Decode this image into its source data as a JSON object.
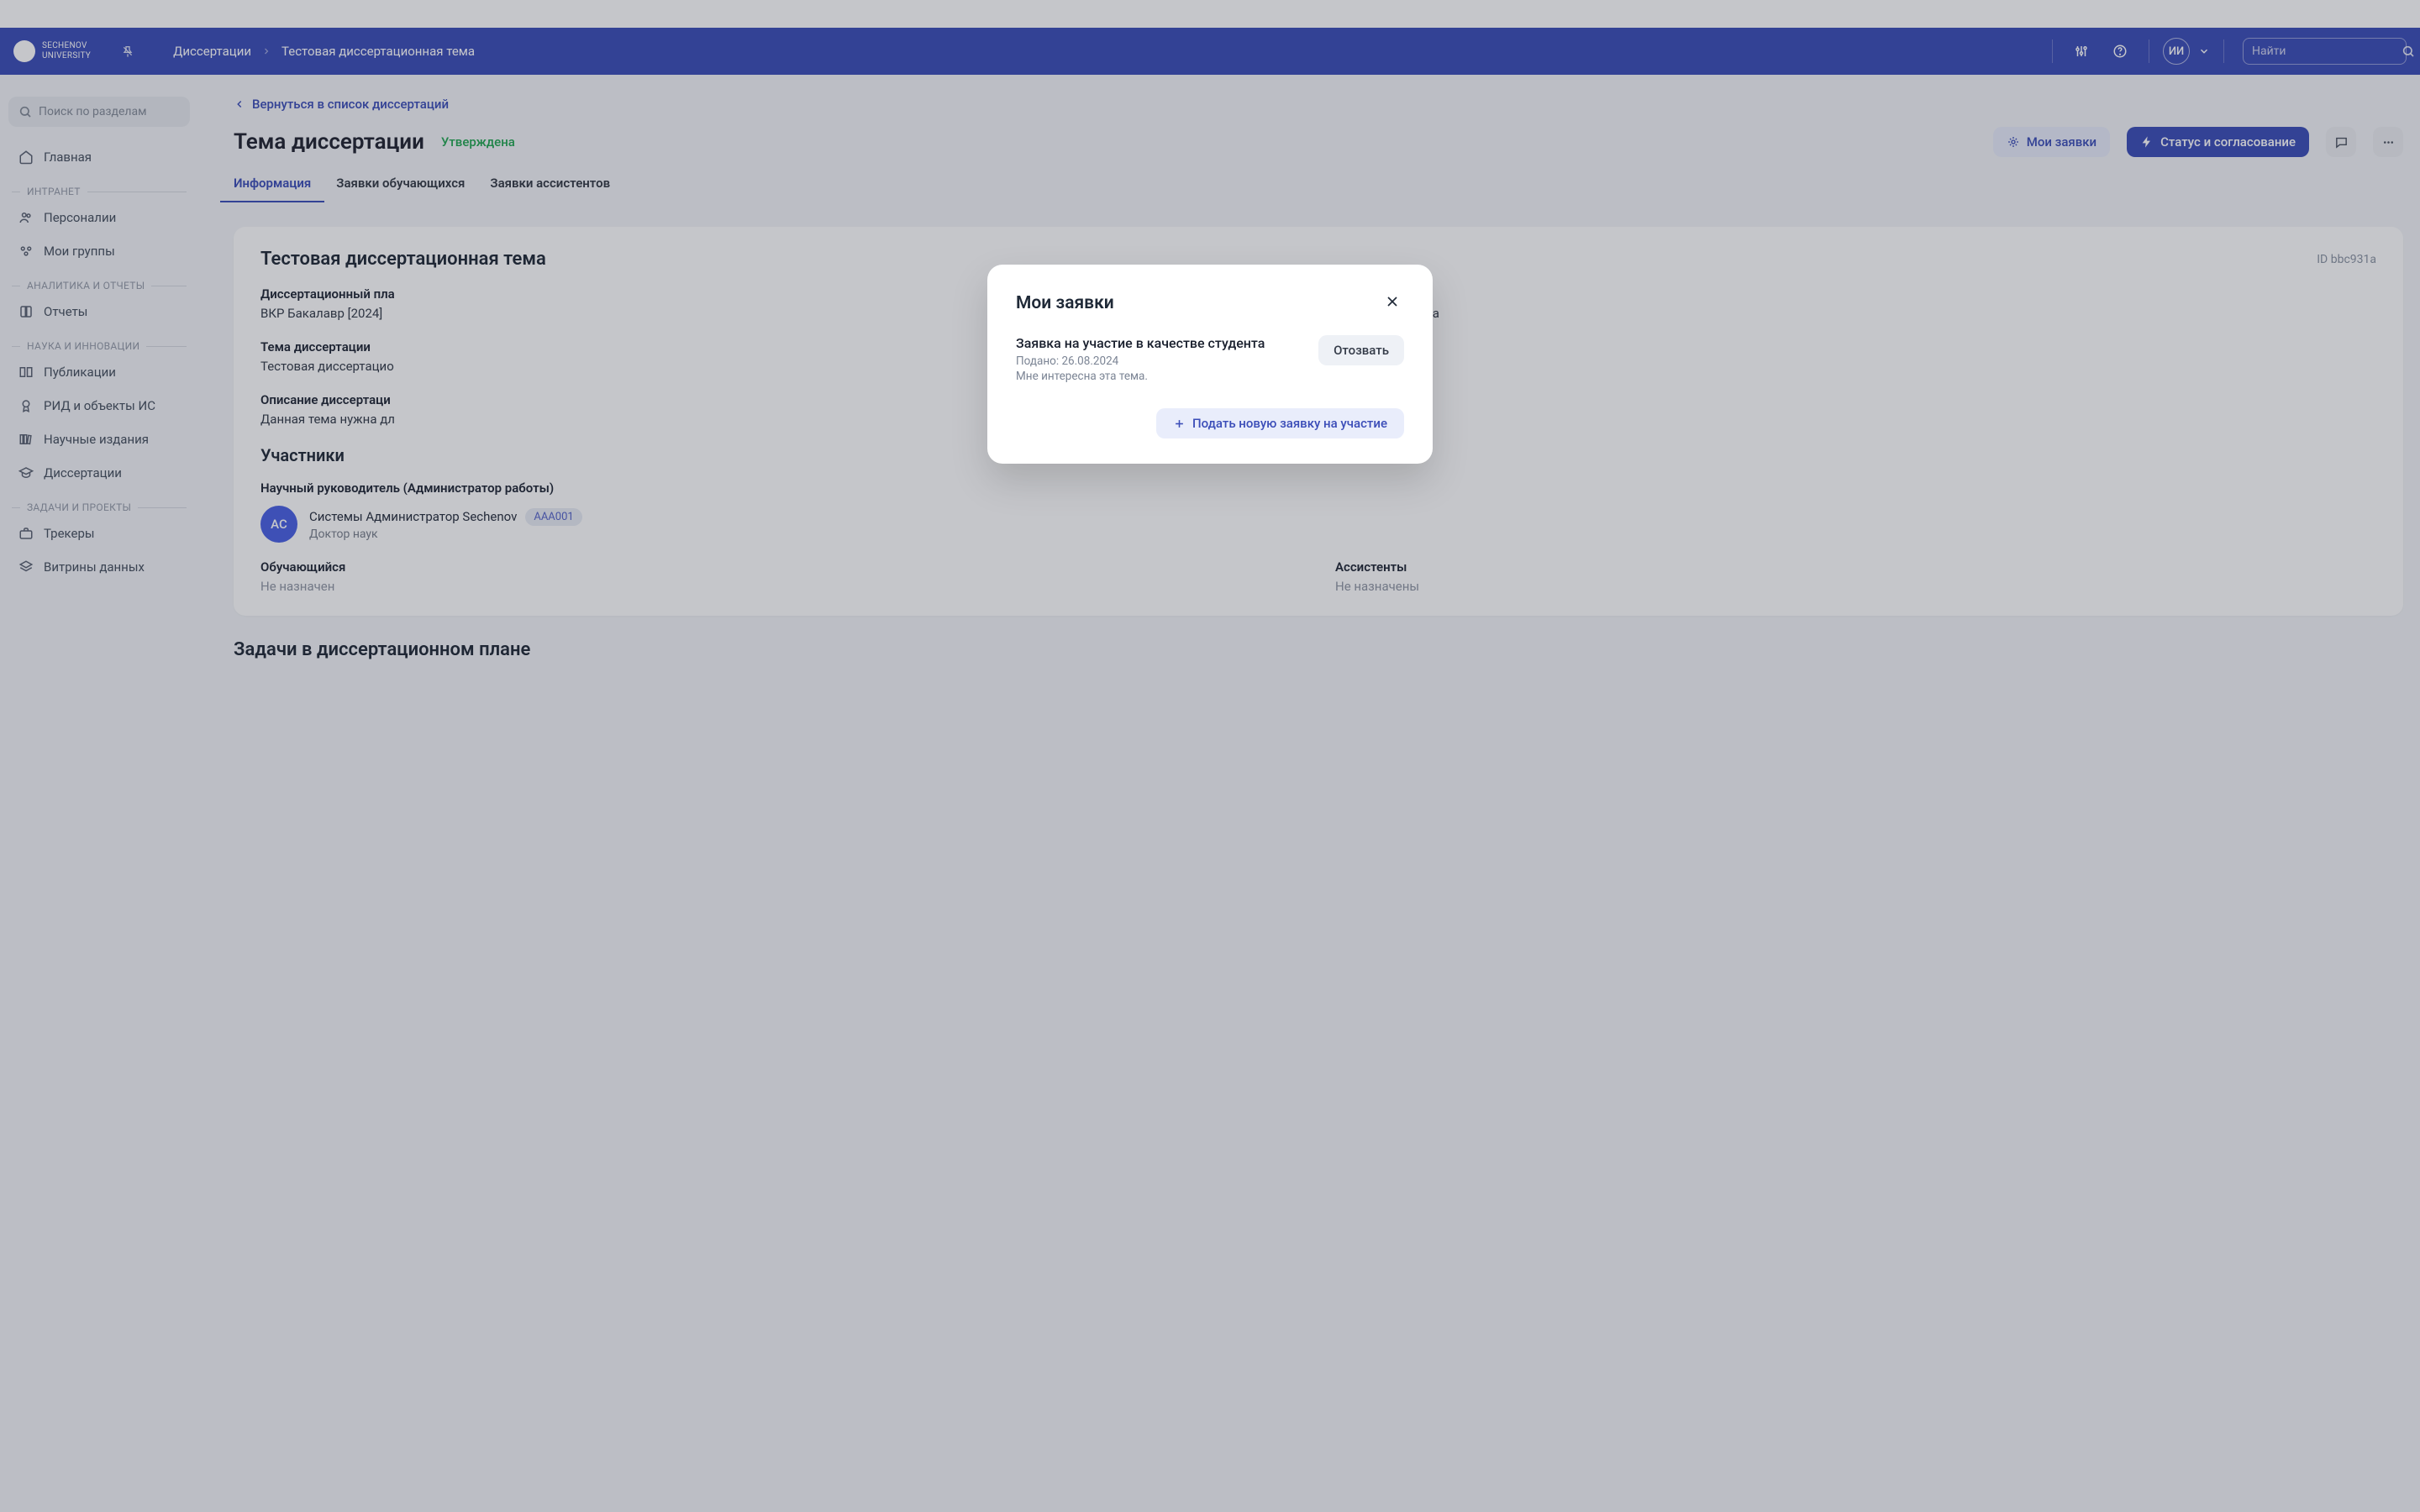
{
  "brand": {
    "line1": "SECHENOV",
    "line2": "UNIVERSITY"
  },
  "breadcrumb": {
    "root": "Диссертации",
    "current": "Тестовая диссертационная тема"
  },
  "header": {
    "avatar_initials": "ИИ",
    "search_placeholder": "Найти"
  },
  "sidebar": {
    "search_placeholder": "Поиск по разделам",
    "items": {
      "home": "Главная",
      "personalii": "Персоналии",
      "my_groups": "Мои группы",
      "reports": "Отчеты",
      "publications": "Публикации",
      "rid_ip": "РИД и объекты ИС",
      "sci_journals": "Научные издания",
      "dissertations": "Диссертации",
      "trackers": "Трекеры",
      "data_showcases": "Витрины данных"
    },
    "sections": {
      "intranet": "ИНТРАНЕТ",
      "analytics": "АНАЛИТИКА И ОТЧЕТЫ",
      "science": "НАУКА И ИННОВАЦИИ",
      "tasks": "ЗАДАЧИ И ПРОЕКТЫ"
    }
  },
  "page": {
    "back_link": "Вернуться в список диссертаций",
    "title": "Тема диссертации",
    "status": "Утверждена",
    "my_applications": "Мои заявки",
    "status_approval": "Статус и согласование"
  },
  "tabs": {
    "info": "Информация",
    "students": "Заявки обучающихся",
    "assistants": "Заявки ассистентов"
  },
  "details": {
    "title": "Тестовая диссертационная тема",
    "id": "ID bbc931a",
    "plan_label": "Диссертационный пла",
    "plan_value": "ВКР Бакалавр [2024]",
    "dept_suffix": "и и менеджмента",
    "topic_label": "Тема диссертации",
    "topic_value": "Тестовая диссертацио",
    "desc_label": "Описание диссертаци",
    "desc_value": "Данная тема нужна дл",
    "participants_heading": "Участники",
    "supervisor_label": "Научный руководитель (Администратор работы)",
    "supervisor_initials": "АС",
    "supervisor_name": "Системы Администратор Sechenov",
    "supervisor_code": "ААА001",
    "supervisor_degree": "Доктор наук",
    "student_label": "Обучающийся",
    "student_value": "Не назначен",
    "assistants_label": "Ассистенты",
    "assistants_value": "Не назначены"
  },
  "plan_section": {
    "title": "Задачи в диссертационном плане"
  },
  "modal": {
    "title": "Мои заявки",
    "app_title": "Заявка на участие в качестве студента",
    "submitted": "Подано: 26.08.2024",
    "note": "Мне интересна эта тема.",
    "recall": "Отозвать",
    "new_application": "Подать новую заявку на участие"
  }
}
